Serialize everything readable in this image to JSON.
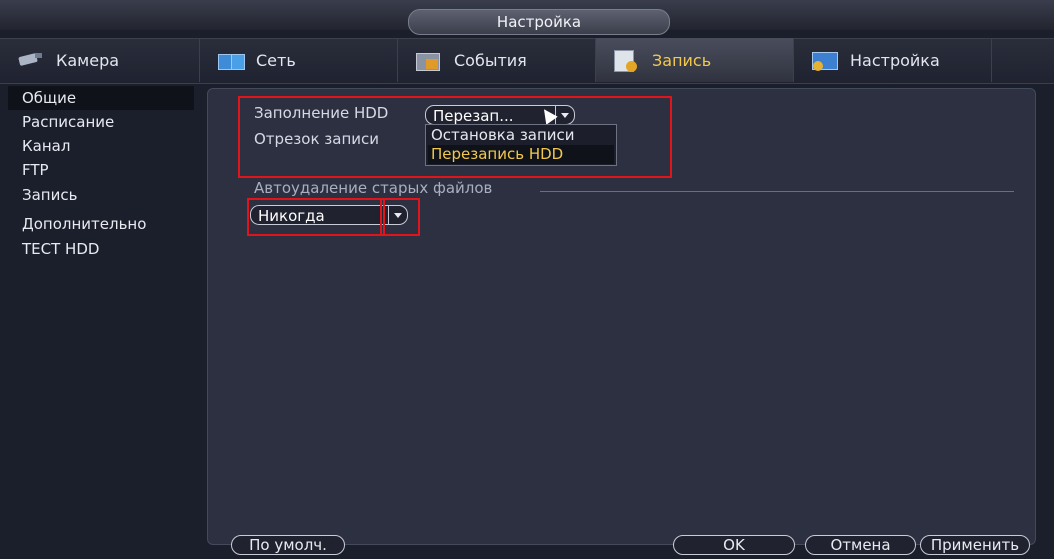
{
  "window": {
    "title": "Настройка"
  },
  "tabs": [
    {
      "label": "Камера",
      "icon": "camera-icon"
    },
    {
      "label": "Сеть",
      "icon": "network-icon"
    },
    {
      "label": "События",
      "icon": "events-icon"
    },
    {
      "label": "Запись",
      "icon": "record-icon",
      "active": true
    },
    {
      "label": "Настройка",
      "icon": "settings-icon"
    }
  ],
  "sidebar": {
    "items": [
      {
        "label": "Общие",
        "active": true
      },
      {
        "label": "Расписание"
      },
      {
        "label": "Канал"
      },
      {
        "label": "FTP"
      },
      {
        "label": "Запись"
      },
      {
        "label": "Дополнительно"
      },
      {
        "label": "ТЕСТ HDD"
      }
    ]
  },
  "form": {
    "hdd_full_label": "Заполнение HDD",
    "hdd_full_value": "Перезап...",
    "hdd_full_options": [
      "Остановка записи",
      "Перезапись HDD"
    ],
    "hdd_full_selected_option": "Перезапись HDD",
    "segment_label": "Отрезок записи",
    "auto_delete_section": "Автоудаление старых файлов",
    "auto_delete_value": "Никогда"
  },
  "buttons": {
    "default": "По умолч.",
    "ok": "OK",
    "cancel": "Отмена",
    "apply": "Применить"
  },
  "colors": {
    "accent": "#f2c94c",
    "highlight": "#e0141b",
    "panel": "#2c3041"
  }
}
